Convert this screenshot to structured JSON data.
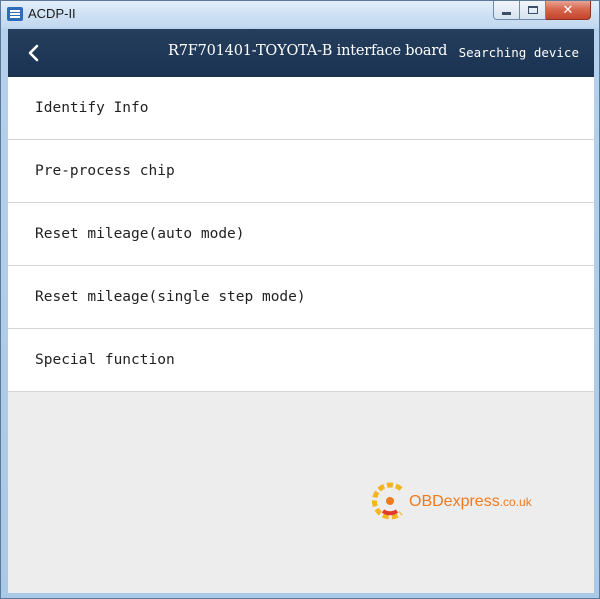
{
  "window": {
    "title": "ACDP-II",
    "minimize_glyph": "",
    "maximize_glyph": "",
    "close_glyph": "✕"
  },
  "header": {
    "back_icon": "chevron-left-icon",
    "title": "R7F701401-TOYOTA-B interface board",
    "status": "Searching device"
  },
  "menu": {
    "items": [
      {
        "label": "Identify Info"
      },
      {
        "label": "Pre-process chip"
      },
      {
        "label": "Reset mileage(auto mode)"
      },
      {
        "label": "Reset mileage(single step mode)"
      },
      {
        "label": "Special function"
      }
    ]
  },
  "watermark": {
    "brand": "OBDexpress",
    "suffix": ".co.uk"
  },
  "colors": {
    "header_bg": "#1b3352",
    "list_bg": "#ffffff",
    "body_bg": "#ededed",
    "watermark": "#ee7a1e"
  }
}
